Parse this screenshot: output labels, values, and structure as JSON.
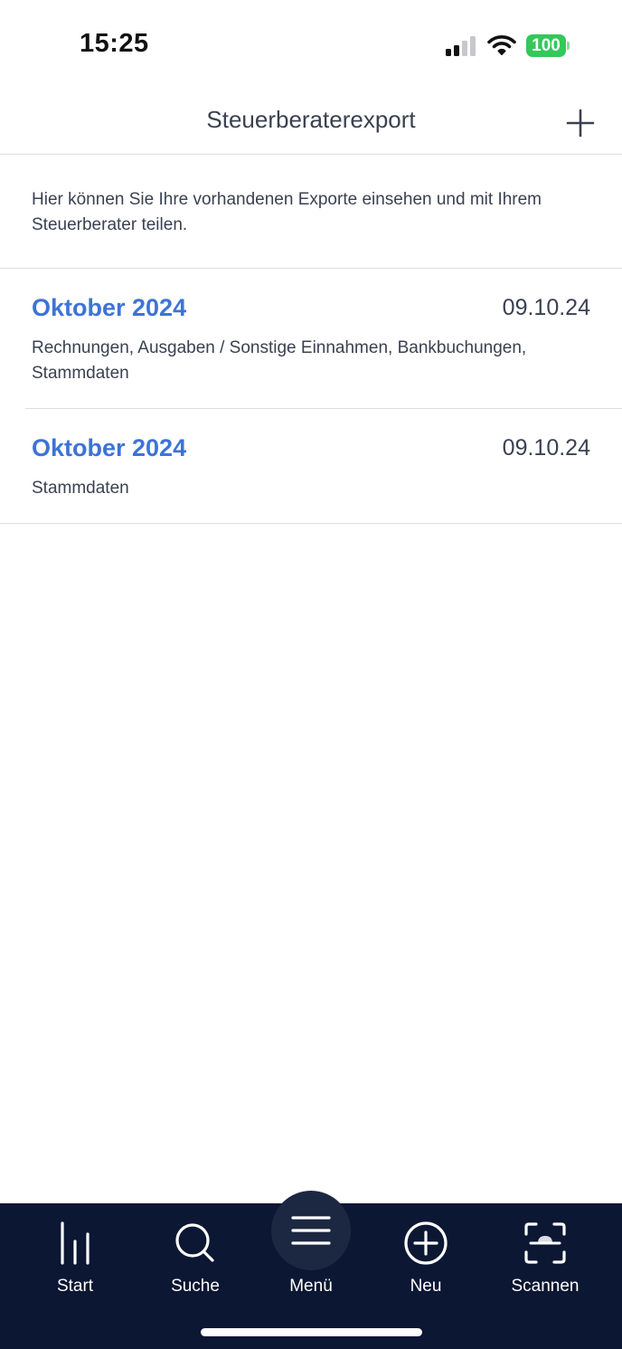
{
  "status_bar": {
    "time": "15:25",
    "battery_level": "100",
    "icons": [
      "signal-icon",
      "wifi-icon",
      "battery-icon"
    ]
  },
  "nav": {
    "title": "Steuerberaterexport",
    "add_icon": "plus-icon"
  },
  "intro": {
    "text": "Hier können Sie Ihre vorhandenen Exporte einsehen und mit Ihrem Steuerberater teilen."
  },
  "exports": [
    {
      "title": "Oktober 2024",
      "date": "09.10.24",
      "description": "Rechnungen, Ausgaben / Sonstige Einnahmen, Bankbuchungen, Stammdaten"
    },
    {
      "title": "Oktober 2024",
      "date": "09.10.24",
      "description": "Stammdaten"
    }
  ],
  "tab_bar": {
    "tabs": [
      {
        "label": "Start",
        "icon": "bar-chart-icon"
      },
      {
        "label": "Suche",
        "icon": "search-icon"
      },
      {
        "label": "Menü",
        "icon": "hamburger-menu-icon"
      },
      {
        "label": "Neu",
        "icon": "plus-circle-icon"
      },
      {
        "label": "Scannen",
        "icon": "scan-icon"
      }
    ]
  },
  "colors": {
    "accent": "#3d73d7",
    "text": "#3a4150",
    "tab_bar_bg": "#0c1733",
    "battery": "#34c759"
  }
}
